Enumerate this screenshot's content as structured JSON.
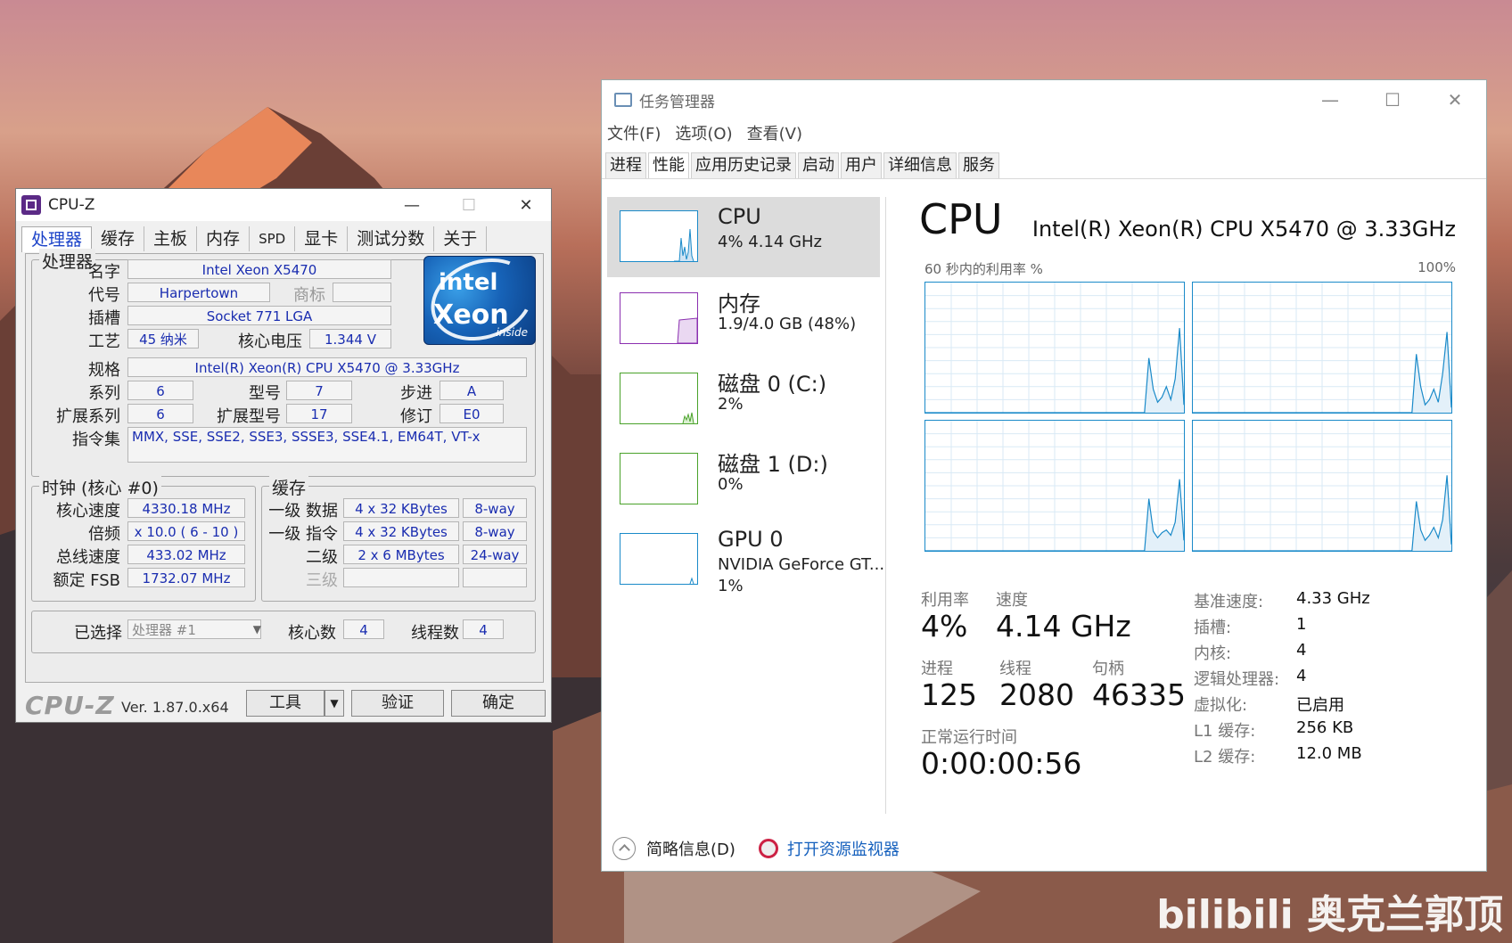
{
  "cpuz": {
    "title": "CPU-Z",
    "tabs": [
      "处理器",
      "缓存",
      "主板",
      "内存",
      "SPD",
      "显卡",
      "测试分数",
      "关于"
    ],
    "processor_group": "处理器",
    "labels": {
      "name": "名字",
      "codename": "代号",
      "brand": "商标",
      "package": "插槽",
      "technology": "工艺",
      "core_voltage": "核心电压",
      "spec": "规格",
      "family": "系列",
      "model": "型号",
      "stepping": "步进",
      "ext_family": "扩展系列",
      "ext_model": "扩展型号",
      "revision": "修订",
      "instructions": "指令集"
    },
    "values": {
      "name": "Intel Xeon X5470",
      "codename": "Harpertown",
      "brand": "",
      "package": "Socket 771 LGA",
      "technology": "45 纳米",
      "core_voltage": "1.344 V",
      "spec": "Intel(R) Xeon(R) CPU          X5470  @ 3.33GHz",
      "family": "6",
      "model": "7",
      "stepping": "A",
      "ext_family": "6",
      "ext_model": "17",
      "revision": "E0",
      "instructions": "MMX, SSE, SSE2, SSE3, SSSE3, SSE4.1, EM64T, VT-x"
    },
    "logo": {
      "brand": "intel",
      "product": "Xeon",
      "tag": "inside"
    },
    "clocks": {
      "title": "时钟 (核心 #0)",
      "core_speed_label": "核心速度",
      "core_speed": "4330.18 MHz",
      "multiplier_label": "倍频",
      "multiplier": "x 10.0 ( 6 - 10 )",
      "bus_speed_label": "总线速度",
      "bus_speed": "433.02 MHz",
      "rated_fsb_label": "额定 FSB",
      "rated_fsb": "1732.07 MHz"
    },
    "cache": {
      "title": "缓存",
      "l1d_label": "一级 数据",
      "l1d": "4 x 32 KBytes",
      "l1d_way": "8-way",
      "l1i_label": "一级 指令",
      "l1i": "4 x 32 KBytes",
      "l1i_way": "8-way",
      "l2_label": "二级",
      "l2": "2 x 6 MBytes",
      "l2_way": "24-way",
      "l3_label": "三级",
      "l3": "",
      "l3_way": ""
    },
    "selection": {
      "selected_label": "已选择",
      "selected_value": "处理器 #1",
      "cores_label": "核心数",
      "cores": "4",
      "threads_label": "线程数",
      "threads": "4"
    },
    "footer": {
      "brand": "CPU-Z",
      "version": "Ver. 1.87.0.x64",
      "tools_label": "工具",
      "validate_label": "验证",
      "ok_label": "确定"
    }
  },
  "taskmgr": {
    "title": "任务管理器",
    "menu": [
      "文件(F)",
      "选项(O)",
      "查看(V)"
    ],
    "tabs": [
      "进程",
      "性能",
      "应用历史记录",
      "启动",
      "用户",
      "详细信息",
      "服务"
    ],
    "sidebar": [
      {
        "name": "CPU",
        "sub": "4%  4.14 GHz",
        "sub2": "",
        "color": "#1a8ac9"
      },
      {
        "name": "内存",
        "sub": "1.9/4.0 GB (48%)",
        "sub2": "",
        "color": "#8b2fb0"
      },
      {
        "name": "磁盘 0 (C:)",
        "sub": "2%",
        "sub2": "",
        "color": "#4aa22a"
      },
      {
        "name": "磁盘 1 (D:)",
        "sub": "0%",
        "sub2": "",
        "color": "#4aa22a"
      },
      {
        "name": "GPU 0",
        "sub": "NVIDIA GeForce GT...",
        "sub2": "1%",
        "color": "#1a8ac9"
      }
    ],
    "cpu_header": "CPU",
    "cpu_model": "Intel(R) Xeon(R) CPU X5470 @ 3.33GHz",
    "graph_caption_left": "60 秒内的利用率 %",
    "graph_caption_right": "100%",
    "graph_color": "#1a8ac9",
    "core_utilization_pct": [
      [
        0,
        0,
        0,
        0,
        0,
        0,
        0,
        0,
        0,
        0,
        0,
        0,
        0,
        0,
        0,
        0,
        0,
        0,
        0,
        0,
        0,
        0,
        0,
        0,
        0,
        0,
        0,
        0,
        0,
        0,
        0,
        0,
        0,
        0,
        0,
        0,
        0,
        0,
        0,
        0,
        0,
        0,
        0,
        0,
        0,
        0,
        0,
        0,
        0,
        0,
        0,
        42,
        18,
        8,
        12,
        20,
        10,
        26,
        65,
        6
      ],
      [
        0,
        0,
        0,
        0,
        0,
        0,
        0,
        0,
        0,
        0,
        0,
        0,
        0,
        0,
        0,
        0,
        0,
        0,
        0,
        0,
        0,
        0,
        0,
        0,
        0,
        0,
        0,
        0,
        0,
        0,
        0,
        0,
        0,
        0,
        0,
        0,
        0,
        0,
        0,
        0,
        0,
        0,
        0,
        0,
        0,
        0,
        0,
        0,
        0,
        0,
        0,
        45,
        20,
        6,
        10,
        18,
        8,
        30,
        62,
        4
      ],
      [
        0,
        0,
        0,
        0,
        0,
        0,
        0,
        0,
        0,
        0,
        0,
        0,
        0,
        0,
        0,
        0,
        0,
        0,
        0,
        0,
        0,
        0,
        0,
        0,
        0,
        0,
        0,
        0,
        0,
        0,
        0,
        0,
        0,
        0,
        0,
        0,
        0,
        0,
        0,
        0,
        0,
        0,
        0,
        0,
        0,
        0,
        0,
        0,
        0,
        0,
        0,
        40,
        15,
        10,
        14,
        16,
        12,
        22,
        55,
        8
      ],
      [
        0,
        0,
        0,
        0,
        0,
        0,
        0,
        0,
        0,
        0,
        0,
        0,
        0,
        0,
        0,
        0,
        0,
        0,
        0,
        0,
        0,
        0,
        0,
        0,
        0,
        0,
        0,
        0,
        0,
        0,
        0,
        0,
        0,
        0,
        0,
        0,
        0,
        0,
        0,
        0,
        0,
        0,
        0,
        0,
        0,
        0,
        0,
        0,
        0,
        0,
        0,
        38,
        16,
        8,
        12,
        18,
        10,
        24,
        58,
        5
      ]
    ],
    "stats": {
      "util_label": "利用率",
      "util": "4%",
      "speed_label": "速度",
      "speed": "4.14 GHz",
      "proc_label": "进程",
      "proc": "125",
      "thread_label": "线程",
      "thread": "2080",
      "handle_label": "句柄",
      "handle": "46335",
      "uptime_label": "正常运行时间",
      "uptime": "0:00:00:56"
    },
    "details": [
      {
        "k": "基准速度:",
        "v": "4.33 GHz"
      },
      {
        "k": "插槽:",
        "v": "1"
      },
      {
        "k": "内核:",
        "v": "4"
      },
      {
        "k": "逻辑处理器:",
        "v": "4"
      },
      {
        "k": "虚拟化:",
        "v": "已启用"
      },
      {
        "k": "L1 缓存:",
        "v": "256 KB"
      },
      {
        "k": "L2 缓存:",
        "v": "12.0 MB"
      }
    ],
    "footer": {
      "less_details": "简略信息(D)",
      "open_resmon": "打开资源监视器"
    }
  },
  "watermark": "bilibili 奥克兰郭顶"
}
